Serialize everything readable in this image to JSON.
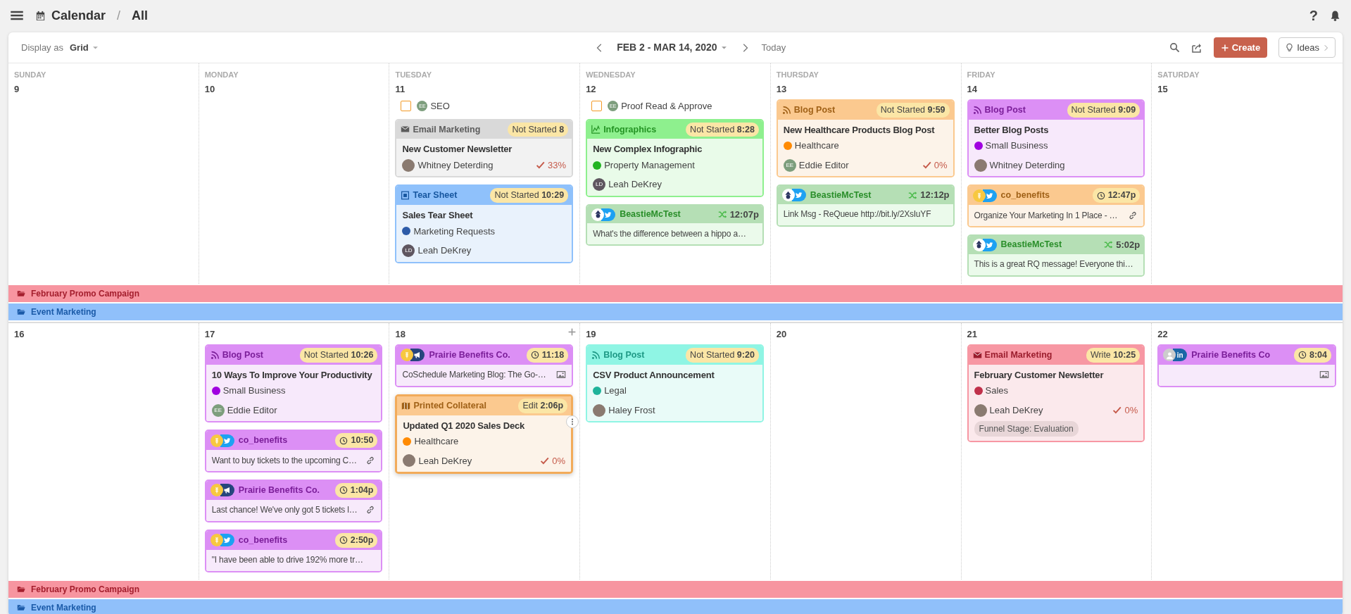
{
  "topbar": {
    "title": "Calendar",
    "separator": "/",
    "view": "All",
    "help": "?"
  },
  "toolbar": {
    "display_label": "Display as",
    "display_value": "Grid",
    "range": "FEB 2 - MAR 14, 2020",
    "today": "Today",
    "create": "Create",
    "ideas": "Ideas"
  },
  "weeks": [
    {
      "days": [
        {
          "weekday": "SUNDAY",
          "date": "9"
        },
        {
          "weekday": "MONDAY",
          "date": "10"
        },
        {
          "weekday": "TUESDAY",
          "date": "11",
          "items": [
            {
              "kind": "task",
              "checked": false,
              "label": "SEO",
              "owner": {
                "kind": "initials",
                "initials": "EE",
                "color": "#7d9e7d"
              }
            },
            {
              "kind": "content",
              "type": {
                "kind": "email",
                "label": "Email Marketing"
              },
              "color": "#d9d9d9",
              "status": "Not Started",
              "time": "8",
              "title": "New Customer Newsletter",
              "owner": {
                "kind": "photo",
                "name": "Whitney Deterding"
              },
              "progress": "33%"
            },
            {
              "kind": "content",
              "type": {
                "kind": "tear_sheet",
                "label": "Tear Sheet"
              },
              "color": "#8fc1fb",
              "status": "Not Started",
              "time": "10:29",
              "title": "Sales Tear Sheet",
              "tag": {
                "label": "Marketing Requests",
                "color": "#2d5ba8"
              },
              "owner": {
                "kind": "initials",
                "initials": "LD",
                "color": "#5f5660",
                "name": "Leah DeKrey"
              }
            }
          ]
        },
        {
          "weekday": "WEDNESDAY",
          "date": "12",
          "items": [
            {
              "kind": "task",
              "checked": false,
              "label": "Proof Read & Approve",
              "owner": {
                "kind": "initials",
                "initials": "EE",
                "color": "#7d9e7d"
              }
            },
            {
              "kind": "content",
              "type": {
                "kind": "infographic",
                "label": "Infographics"
              },
              "color": "#8ef08e",
              "status": "Not Started",
              "time": "8:28",
              "title": "New Complex Infographic",
              "tag": {
                "label": "Property Management",
                "color": "#22b422"
              },
              "owner": {
                "kind": "initials",
                "initials": "LD",
                "color": "#5f5660",
                "name": "Leah DeKrey"
              }
            },
            {
              "kind": "social",
              "color": "#b5dfb5",
              "account": {
                "kind": "cartoon"
              },
              "network": {
                "kind": "twitter"
              },
              "name": "BeastieMcTest",
              "time": {
                "kind": "requeue",
                "text": "12:07p"
              },
              "message": "What's the difference between a hippo a…"
            }
          ]
        },
        {
          "weekday": "THURSDAY",
          "date": "13",
          "items": [
            {
              "kind": "content",
              "type": {
                "kind": "blog",
                "label": "Blog Post"
              },
              "color": "#fbc98f",
              "status": "Not Started",
              "time": "9:59",
              "title": "New Healthcare Products Blog Post",
              "tag": {
                "label": "Healthcare",
                "color": "#ff8a00"
              },
              "owner": {
                "kind": "initials",
                "initials": "EE",
                "color": "#7d9e7d",
                "name": "Eddie Editor"
              },
              "progress": "0%"
            },
            {
              "kind": "social",
              "color": "#b5dfb5",
              "account": {
                "kind": "cartoon"
              },
              "network": {
                "kind": "twitter"
              },
              "name": "BeastieMcTest",
              "time": {
                "kind": "requeue",
                "text": "12:12p"
              },
              "message": "Link Msg - ReQueue http://bit.ly/2XsIuYF"
            }
          ]
        },
        {
          "weekday": "FRIDAY",
          "date": "14",
          "items": [
            {
              "kind": "content",
              "type": {
                "kind": "blog",
                "label": "Blog Post"
              },
              "color": "#dc8ff5",
              "status": "Not Started",
              "time": "9:09",
              "title": "Better Blog Posts",
              "tag": {
                "label": "Small Business",
                "color": "#a000e0"
              },
              "owner": {
                "kind": "photo",
                "name": "Whitney Deterding"
              }
            },
            {
              "kind": "social",
              "color": "#fbc98f",
              "account": {
                "kind": "wheat"
              },
              "network": {
                "kind": "twitter"
              },
              "name": "co_benefits",
              "time": {
                "kind": "clock",
                "text": "12:47p"
              },
              "message": "Organize Your Marketing In 1 Place - …",
              "attachment": {
                "kind": "link"
              }
            },
            {
              "kind": "social",
              "color": "#b5dfb5",
              "account": {
                "kind": "cartoon"
              },
              "network": {
                "kind": "twitter"
              },
              "name": "BeastieMcTest",
              "time": {
                "kind": "requeue",
                "text": "5:02p"
              },
              "message": "This is a great RQ message! Everyone thi…"
            }
          ]
        },
        {
          "weekday": "SATURDAY",
          "date": "15"
        }
      ],
      "bands": [
        {
          "label": "February Promo Campaign",
          "color": "#f795a0"
        },
        {
          "label": "Event Marketing",
          "color": "#90c0fa"
        }
      ]
    },
    {
      "days": [
        {
          "date": "16"
        },
        {
          "date": "17",
          "items": [
            {
              "kind": "content",
              "type": {
                "kind": "blog",
                "label": "Blog Post"
              },
              "color": "#dc8ff5",
              "status": "Not Started",
              "time": "10:26",
              "title": "10 Ways To Improve Your Productivity",
              "tag": {
                "label": "Small Business",
                "color": "#a000e0"
              },
              "owner": {
                "kind": "initials",
                "initials": "EE",
                "color": "#7d9e7d",
                "name": "Eddie Editor"
              }
            },
            {
              "kind": "social",
              "color": "#dc8ff5",
              "account": {
                "kind": "wheat"
              },
              "network": {
                "kind": "twitter"
              },
              "name": "co_benefits",
              "time": {
                "kind": "clock",
                "text": "10:50"
              },
              "message": "Want to buy tickets to the upcoming C…",
              "attachment": {
                "kind": "link"
              }
            },
            {
              "kind": "social",
              "color": "#dc8ff5",
              "account": {
                "kind": "wheat"
              },
              "network": {
                "kind": "megaphone"
              },
              "name": "Prairie Benefits Co.",
              "time": {
                "kind": "clock",
                "text": "1:04p"
              },
              "message": "Last chance! We've only got 5 tickets l…",
              "attachment": {
                "kind": "link"
              }
            },
            {
              "kind": "social",
              "color": "#dc8ff5",
              "account": {
                "kind": "wheat"
              },
              "network": {
                "kind": "twitter"
              },
              "name": "co_benefits",
              "time": {
                "kind": "clock",
                "text": "2:50p"
              },
              "message": "\"I have been able to drive 192% more tr…"
            }
          ]
        },
        {
          "date": "18",
          "add_shown": true,
          "items": [
            {
              "kind": "social",
              "color": "#dc8ff5",
              "account": {
                "kind": "wheat"
              },
              "network": {
                "kind": "megaphone"
              },
              "name": "Prairie Benefits Co.",
              "time": {
                "kind": "clock",
                "text": "11:18"
              },
              "message": "CoSchedule Marketing Blog: The Go-…",
              "attachment": {
                "kind": "image"
              }
            },
            {
              "kind": "content",
              "type": {
                "kind": "print",
                "label": "Printed Collateral"
              },
              "color": "#fbc98f",
              "hovered": true,
              "status": "Edit",
              "time": "2:06p",
              "title": "Updated Q1 2020 Sales Deck",
              "tag": {
                "label": "Healthcare",
                "color": "#ff8a00"
              },
              "owner": {
                "kind": "photo",
                "name": "Leah DeKrey"
              },
              "progress": "0%"
            }
          ]
        },
        {
          "date": "19",
          "items": [
            {
              "kind": "content",
              "type": {
                "kind": "blog",
                "label": "Blog Post"
              },
              "color": "#8ff5e4",
              "status": "Not Started",
              "time": "9:20",
              "title": "CSV Product Announcement",
              "tag": {
                "label": "Legal",
                "color": "#1fb39a"
              },
              "owner": {
                "kind": "photo",
                "name": "Haley Frost"
              }
            }
          ]
        },
        {
          "date": "20"
        },
        {
          "date": "21",
          "items": [
            {
              "kind": "content",
              "type": {
                "kind": "email",
                "label": "Email Marketing"
              },
              "color": "#f797a3",
              "status": "Write",
              "time": "10:25",
              "title": "February Customer Newsletter",
              "tag": {
                "label": "Sales",
                "color": "#c0304a"
              },
              "owner": {
                "kind": "photo",
                "name": "Leah DeKrey"
              },
              "progress": "0%",
              "funnel": "Funnel Stage: Evaluation"
            }
          ]
        },
        {
          "date": "22",
          "items": [
            {
              "kind": "social",
              "color": "#dc8ff5",
              "account": {
                "kind": "person"
              },
              "network": {
                "kind": "linkedin",
                "label": "in"
              },
              "name": "Prairie Benefits Co",
              "time": {
                "kind": "clock",
                "text": "8:04"
              },
              "attachment": {
                "kind": "image"
              }
            }
          ]
        }
      ],
      "bands": [
        {
          "label": "February Promo Campaign",
          "color": "#f795a0"
        },
        {
          "label": "Event Marketing",
          "color": "#90c0fa"
        }
      ]
    }
  ]
}
